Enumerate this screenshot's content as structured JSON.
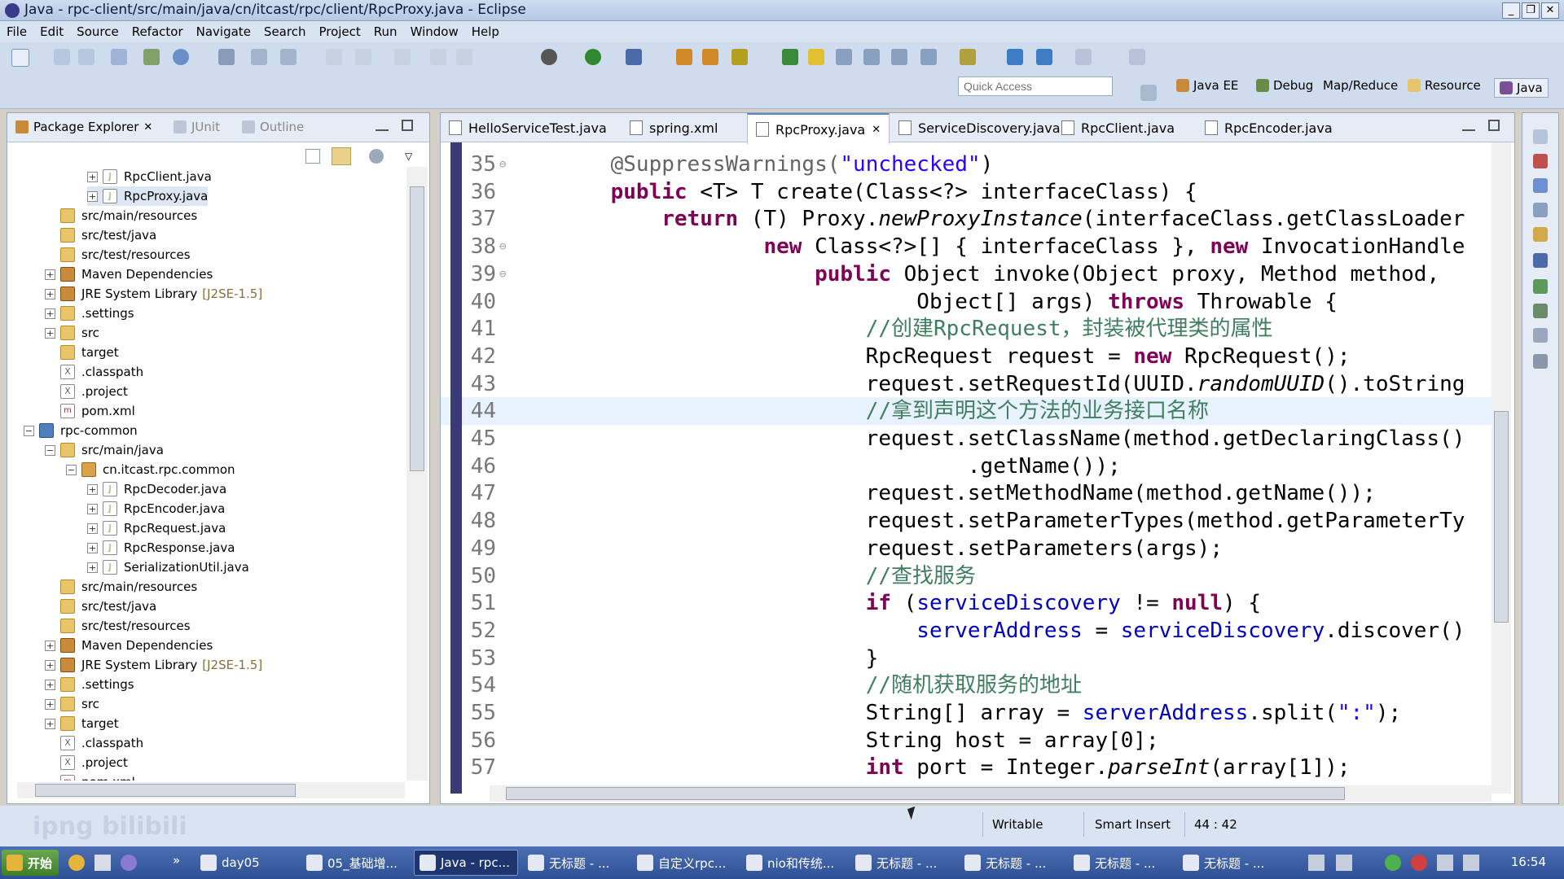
{
  "window": {
    "title": "Java - rpc-client/src/main/java/cn/itcast/rpc/client/RpcProxy.java - Eclipse",
    "minimize": "_",
    "restore": "❐",
    "close": "✕"
  },
  "menu": [
    "File",
    "Edit",
    "Source",
    "Refactor",
    "Navigate",
    "Search",
    "Project",
    "Run",
    "Window",
    "Help"
  ],
  "quick_access": {
    "placeholder": "Quick Access"
  },
  "perspectives": [
    {
      "label": "Java EE",
      "icon": "java-ee-icon"
    },
    {
      "label": "Debug",
      "icon": "debug-icon"
    },
    {
      "label": "Map/Reduce",
      "icon": ""
    },
    {
      "label": "Resource",
      "icon": "resource-icon"
    },
    {
      "label": "Java",
      "icon": "java-icon"
    }
  ],
  "left_panel": {
    "tabs": [
      "Package Explorer",
      "JUnit",
      "Outline"
    ],
    "active_tab": "Package Explorer"
  },
  "tree": [
    {
      "depth": 3,
      "toggle": "+",
      "icon": "java",
      "label": "RpcClient.java",
      "decoration": ""
    },
    {
      "depth": 3,
      "toggle": "+",
      "icon": "java",
      "label": "RpcProxy.java",
      "decoration": "",
      "selected": true
    },
    {
      "depth": 1,
      "toggle": "",
      "icon": "folder",
      "label": "src/main/resources",
      "decoration": ""
    },
    {
      "depth": 1,
      "toggle": "",
      "icon": "folder",
      "label": "src/test/java",
      "decoration": ""
    },
    {
      "depth": 1,
      "toggle": "",
      "icon": "folder",
      "label": "src/test/resources",
      "decoration": ""
    },
    {
      "depth": 1,
      "toggle": "+",
      "icon": "lib",
      "label": "Maven Dependencies",
      "decoration": ""
    },
    {
      "depth": 1,
      "toggle": "+",
      "icon": "lib",
      "label": "JRE System Library",
      "decoration": "[J2SE-1.5]"
    },
    {
      "depth": 1,
      "toggle": "+",
      "icon": "folder",
      "label": ".settings",
      "decoration": ""
    },
    {
      "depth": 1,
      "toggle": "+",
      "icon": "folder",
      "label": "src",
      "decoration": ""
    },
    {
      "depth": 1,
      "toggle": "",
      "icon": "folder",
      "label": "target",
      "decoration": ""
    },
    {
      "depth": 1,
      "toggle": "",
      "icon": "xml",
      "label": ".classpath",
      "decoration": ""
    },
    {
      "depth": 1,
      "toggle": "",
      "icon": "xml",
      "label": ".project",
      "decoration": ""
    },
    {
      "depth": 1,
      "toggle": "",
      "icon": "pom",
      "label": "pom.xml",
      "decoration": ""
    },
    {
      "depth": 0,
      "toggle": "−",
      "icon": "proj",
      "label": "rpc-common",
      "decoration": ""
    },
    {
      "depth": 1,
      "toggle": "−",
      "icon": "folder",
      "label": "src/main/java",
      "decoration": ""
    },
    {
      "depth": 2,
      "toggle": "−",
      "icon": "pkg",
      "label": "cn.itcast.rpc.common",
      "decoration": ""
    },
    {
      "depth": 3,
      "toggle": "+",
      "icon": "java",
      "label": "RpcDecoder.java",
      "decoration": ""
    },
    {
      "depth": 3,
      "toggle": "+",
      "icon": "java",
      "label": "RpcEncoder.java",
      "decoration": ""
    },
    {
      "depth": 3,
      "toggle": "+",
      "icon": "java",
      "label": "RpcRequest.java",
      "decoration": ""
    },
    {
      "depth": 3,
      "toggle": "+",
      "icon": "java",
      "label": "RpcResponse.java",
      "decoration": ""
    },
    {
      "depth": 3,
      "toggle": "+",
      "icon": "java",
      "label": "SerializationUtil.java",
      "decoration": ""
    },
    {
      "depth": 1,
      "toggle": "",
      "icon": "folder",
      "label": "src/main/resources",
      "decoration": ""
    },
    {
      "depth": 1,
      "toggle": "",
      "icon": "folder",
      "label": "src/test/java",
      "decoration": ""
    },
    {
      "depth": 1,
      "toggle": "",
      "icon": "folder",
      "label": "src/test/resources",
      "decoration": ""
    },
    {
      "depth": 1,
      "toggle": "+",
      "icon": "lib",
      "label": "Maven Dependencies",
      "decoration": ""
    },
    {
      "depth": 1,
      "toggle": "+",
      "icon": "lib",
      "label": "JRE System Library",
      "decoration": "[J2SE-1.5]"
    },
    {
      "depth": 1,
      "toggle": "+",
      "icon": "folder",
      "label": ".settings",
      "decoration": ""
    },
    {
      "depth": 1,
      "toggle": "+",
      "icon": "folder",
      "label": "src",
      "decoration": ""
    },
    {
      "depth": 1,
      "toggle": "+",
      "icon": "folder",
      "label": "target",
      "decoration": ""
    },
    {
      "depth": 1,
      "toggle": "",
      "icon": "xml",
      "label": ".classpath",
      "decoration": ""
    },
    {
      "depth": 1,
      "toggle": "",
      "icon": "xml",
      "label": ".project",
      "decoration": ""
    },
    {
      "depth": 1,
      "toggle": "",
      "icon": "pom",
      "label": "pom.xml",
      "decoration": ""
    }
  ],
  "editor_tabs": [
    {
      "label": "HelloServiceTest.java",
      "active": false
    },
    {
      "label": "spring.xml",
      "active": false
    },
    {
      "label": "RpcProxy.java",
      "active": true
    },
    {
      "label": "ServiceDiscovery.java",
      "active": false
    },
    {
      "label": "RpcClient.java",
      "active": false
    },
    {
      "label": "RpcEncoder.java",
      "active": false
    }
  ],
  "code": {
    "current_line": 44,
    "lines": [
      {
        "n": "35",
        "fold": "⊖",
        "segs": [
          [
            "    ",
            "t"
          ],
          [
            "@SuppressWarnings(",
            "ann"
          ],
          [
            "\"unchecked\"",
            "str"
          ],
          [
            ")",
            "t"
          ]
        ]
      },
      {
        "n": "36",
        "fold": "",
        "segs": [
          [
            "    ",
            "t"
          ],
          [
            "public",
            "kw"
          ],
          [
            " <T> T create(Class<?> interfaceClass) {",
            "t"
          ]
        ]
      },
      {
        "n": "37",
        "fold": "",
        "segs": [
          [
            "        ",
            "t"
          ],
          [
            "return",
            "kw"
          ],
          [
            " (T) Proxy.",
            "t"
          ],
          [
            "newProxyInstance",
            "it"
          ],
          [
            "(interfaceClass.getClassLoader",
            "t"
          ]
        ]
      },
      {
        "n": "38",
        "fold": "⊖",
        "segs": [
          [
            "                ",
            "t"
          ],
          [
            "new",
            "kw"
          ],
          [
            " Class<?>[] { interfaceClass }, ",
            "t"
          ],
          [
            "new",
            "kw"
          ],
          [
            " InvocationHandle",
            "t"
          ]
        ]
      },
      {
        "n": "39",
        "fold": "⊖",
        "segs": [
          [
            "                    ",
            "t"
          ],
          [
            "public",
            "kw"
          ],
          [
            " Object invoke(Object proxy, Method method,",
            "t"
          ]
        ]
      },
      {
        "n": "40",
        "fold": "",
        "segs": [
          [
            "                            Object[] args) ",
            "t"
          ],
          [
            "throws",
            "kw"
          ],
          [
            " Throwable {",
            "t"
          ]
        ]
      },
      {
        "n": "41",
        "fold": "",
        "segs": [
          [
            "                        ",
            "t"
          ],
          [
            "//创建RpcRequest，封装被代理类的属性",
            "cm"
          ]
        ]
      },
      {
        "n": "42",
        "fold": "",
        "segs": [
          [
            "                        RpcRequest request = ",
            "t"
          ],
          [
            "new",
            "kw"
          ],
          [
            " RpcRequest();",
            "t"
          ]
        ]
      },
      {
        "n": "43",
        "fold": "",
        "segs": [
          [
            "                        request.setRequestId(UUID.",
            "t"
          ],
          [
            "randomUUID",
            "it"
          ],
          [
            "().toString",
            "t"
          ]
        ]
      },
      {
        "n": "44",
        "fold": "",
        "segs": [
          [
            "                        ",
            "t"
          ],
          [
            "//拿到声明这个方法的业务接口名称",
            "cm"
          ]
        ]
      },
      {
        "n": "45",
        "fold": "",
        "segs": [
          [
            "                        request.setClassName(method.getDeclaringClass()",
            "t"
          ]
        ]
      },
      {
        "n": "46",
        "fold": "",
        "segs": [
          [
            "                                .getName());",
            "t"
          ]
        ]
      },
      {
        "n": "47",
        "fold": "",
        "segs": [
          [
            "                        request.setMethodName(method.getName());",
            "t"
          ]
        ]
      },
      {
        "n": "48",
        "fold": "",
        "segs": [
          [
            "                        request.setParameterTypes(method.getParameterTy",
            "t"
          ]
        ]
      },
      {
        "n": "49",
        "fold": "",
        "segs": [
          [
            "                        request.setParameters(args);",
            "t"
          ]
        ]
      },
      {
        "n": "50",
        "fold": "",
        "segs": [
          [
            "                        ",
            "t"
          ],
          [
            "//查找服务",
            "cm"
          ]
        ]
      },
      {
        "n": "51",
        "fold": "",
        "segs": [
          [
            "                        ",
            "t"
          ],
          [
            "if",
            "kw"
          ],
          [
            " (",
            "t"
          ],
          [
            "serviceDiscovery",
            "fld"
          ],
          [
            " != ",
            "t"
          ],
          [
            "null",
            "kw"
          ],
          [
            ") {",
            "t"
          ]
        ]
      },
      {
        "n": "52",
        "fold": "",
        "segs": [
          [
            "                            ",
            "t"
          ],
          [
            "serverAddress",
            "fld"
          ],
          [
            " = ",
            "t"
          ],
          [
            "serviceDiscovery",
            "fld"
          ],
          [
            ".discover()",
            "t"
          ]
        ]
      },
      {
        "n": "53",
        "fold": "",
        "segs": [
          [
            "                        }",
            "t"
          ]
        ]
      },
      {
        "n": "54",
        "fold": "",
        "segs": [
          [
            "                        ",
            "t"
          ],
          [
            "//随机获取服务的地址",
            "cm"
          ]
        ]
      },
      {
        "n": "55",
        "fold": "",
        "segs": [
          [
            "                        String[] array = ",
            "t"
          ],
          [
            "serverAddress",
            "fld"
          ],
          [
            ".split(",
            "t"
          ],
          [
            "\":\"",
            "str"
          ],
          [
            ");",
            "t"
          ]
        ]
      },
      {
        "n": "56",
        "fold": "",
        "segs": [
          [
            "                        String host = array[0];",
            "t"
          ]
        ]
      },
      {
        "n": "57",
        "fold": "",
        "segs": [
          [
            "                        ",
            "t"
          ],
          [
            "int",
            "kw"
          ],
          [
            " port = Integer.",
            "t"
          ],
          [
            "parseInt",
            "it"
          ],
          [
            "(array[1]);",
            "t"
          ]
        ]
      }
    ]
  },
  "status": {
    "writable": "Writable",
    "insert_mode": "Smart Insert",
    "position": "44 : 42"
  },
  "watermark": "ipng bilibili",
  "taskbar": {
    "start": "开始",
    "items": [
      {
        "label": "day05",
        "active": false
      },
      {
        "label": "05_基础增...",
        "active": false
      },
      {
        "label": "Java - rpc...",
        "active": true
      },
      {
        "label": "无标题 - ...",
        "active": false
      },
      {
        "label": "自定义rpc...",
        "active": false
      },
      {
        "label": "nio和传统...",
        "active": false
      },
      {
        "label": "无标题 - ...",
        "active": false
      },
      {
        "label": "无标题 - ...",
        "active": false
      },
      {
        "label": "无标题 - ...",
        "active": false
      },
      {
        "label": "无标题 - ...",
        "active": false
      }
    ],
    "clock": "16:54"
  }
}
